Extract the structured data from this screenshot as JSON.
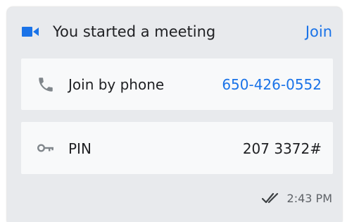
{
  "header": {
    "icon": "video-camera-icon",
    "title": "You started a meeting",
    "join_label": "Join"
  },
  "phone_row": {
    "icon": "phone-icon",
    "label": "Join by phone",
    "number": "650-426-0552"
  },
  "pin_row": {
    "icon": "key-icon",
    "label": "PIN",
    "value": "207 3372#"
  },
  "footer": {
    "status_icon": "double-check-icon",
    "time": "2:43 PM"
  },
  "colors": {
    "accent": "#1a73e8",
    "card_background": "#e8eaed",
    "row_background": "#f8f9fa",
    "text": "#202124",
    "muted": "#5f6368"
  }
}
